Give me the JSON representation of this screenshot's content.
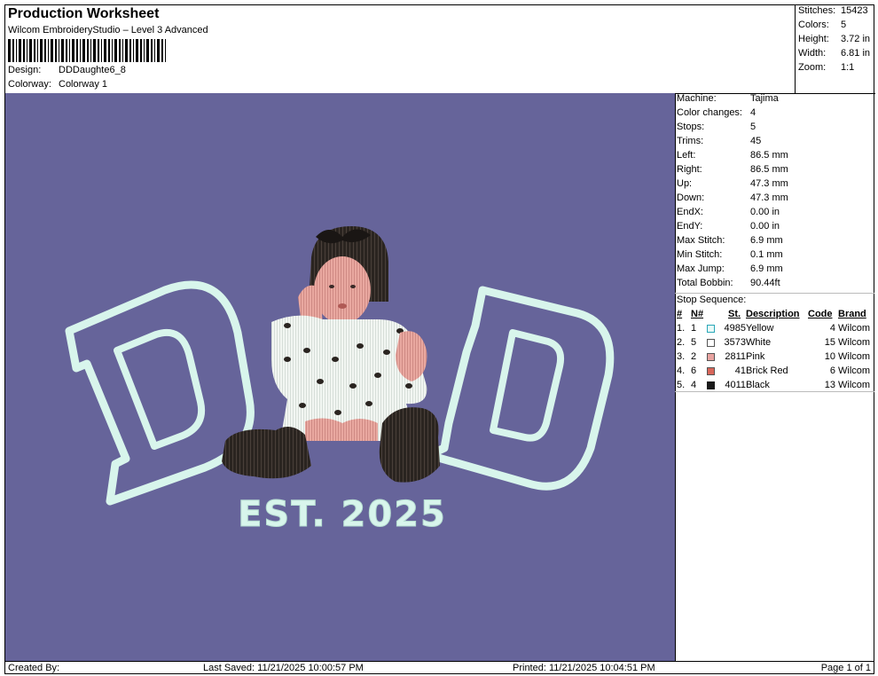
{
  "header": {
    "title": "Production Worksheet",
    "software": "Wilcom EmbroideryStudio – Level 3 Advanced",
    "design_label": "Design:",
    "design_value": "DDDaughte6_8",
    "colorway_label": "Colorway:",
    "colorway_value": "Colorway 1"
  },
  "stats": [
    {
      "label": "Stitches:",
      "value": "15423"
    },
    {
      "label": "Colors:",
      "value": "5"
    },
    {
      "label": "Height:",
      "value": "3.72 in"
    },
    {
      "label": "Width:",
      "value": "6.81 in"
    },
    {
      "label": "Zoom:",
      "value": "1:1"
    }
  ],
  "machine_info": [
    {
      "label": "Machine:",
      "value": "Tajima"
    },
    {
      "label": "Color changes:",
      "value": "4"
    },
    {
      "label": "Stops:",
      "value": "5"
    },
    {
      "label": "Trims:",
      "value": "45"
    },
    {
      "label": "Left:",
      "value": "86.5 mm"
    },
    {
      "label": "Right:",
      "value": "86.5 mm"
    },
    {
      "label": "Up:",
      "value": "47.3 mm"
    },
    {
      "label": "Down:",
      "value": "47.3 mm"
    },
    {
      "label": "EndX:",
      "value": "0.00 in"
    },
    {
      "label": "EndY:",
      "value": "0.00 in"
    },
    {
      "label": "Max Stitch:",
      "value": "6.9 mm"
    },
    {
      "label": "Min Stitch:",
      "value": "0.1 mm"
    },
    {
      "label": "Max Jump:",
      "value": "6.9 mm"
    },
    {
      "label": "Total Bobbin:",
      "value": "90.44ft"
    }
  ],
  "stop_sequence": {
    "title": "Stop Sequence:",
    "columns": {
      "num": "#",
      "n": "N#",
      "st": "St.",
      "desc": "Description",
      "code": "Code",
      "brand": "Brand"
    },
    "rows": [
      {
        "num": "1.",
        "n": "1",
        "st": "4985",
        "desc": "Yellow",
        "code": "4",
        "brand": "Wilcom",
        "color": "#e8fbf8",
        "border": "#2aa7b8"
      },
      {
        "num": "2.",
        "n": "5",
        "st": "3573",
        "desc": "White",
        "code": "15",
        "brand": "Wilcom",
        "color": "#ffffff",
        "border": "#555555"
      },
      {
        "num": "3.",
        "n": "2",
        "st": "2811",
        "desc": "Pink",
        "code": "10",
        "brand": "Wilcom",
        "color": "#e8a3a0",
        "border": "#555555"
      },
      {
        "num": "4.",
        "n": "6",
        "st": "41",
        "desc": "Brick Red",
        "code": "6",
        "brand": "Wilcom",
        "color": "#d8665a",
        "border": "#555555"
      },
      {
        "num": "5.",
        "n": "4",
        "st": "4011",
        "desc": "Black",
        "code": "13",
        "brand": "Wilcom",
        "color": "#1a1a1a",
        "border": "#1a1a1a"
      }
    ]
  },
  "design": {
    "background": "#66649a",
    "thread_mint": "#d8f5ec",
    "text": "EST. 2025"
  },
  "footer": {
    "created_by": "Created By:",
    "last_saved": "Last Saved: 11/21/2025 10:00:57 PM",
    "printed": "Printed: 11/21/2025 10:04:51 PM",
    "page": "Page 1 of 1"
  }
}
